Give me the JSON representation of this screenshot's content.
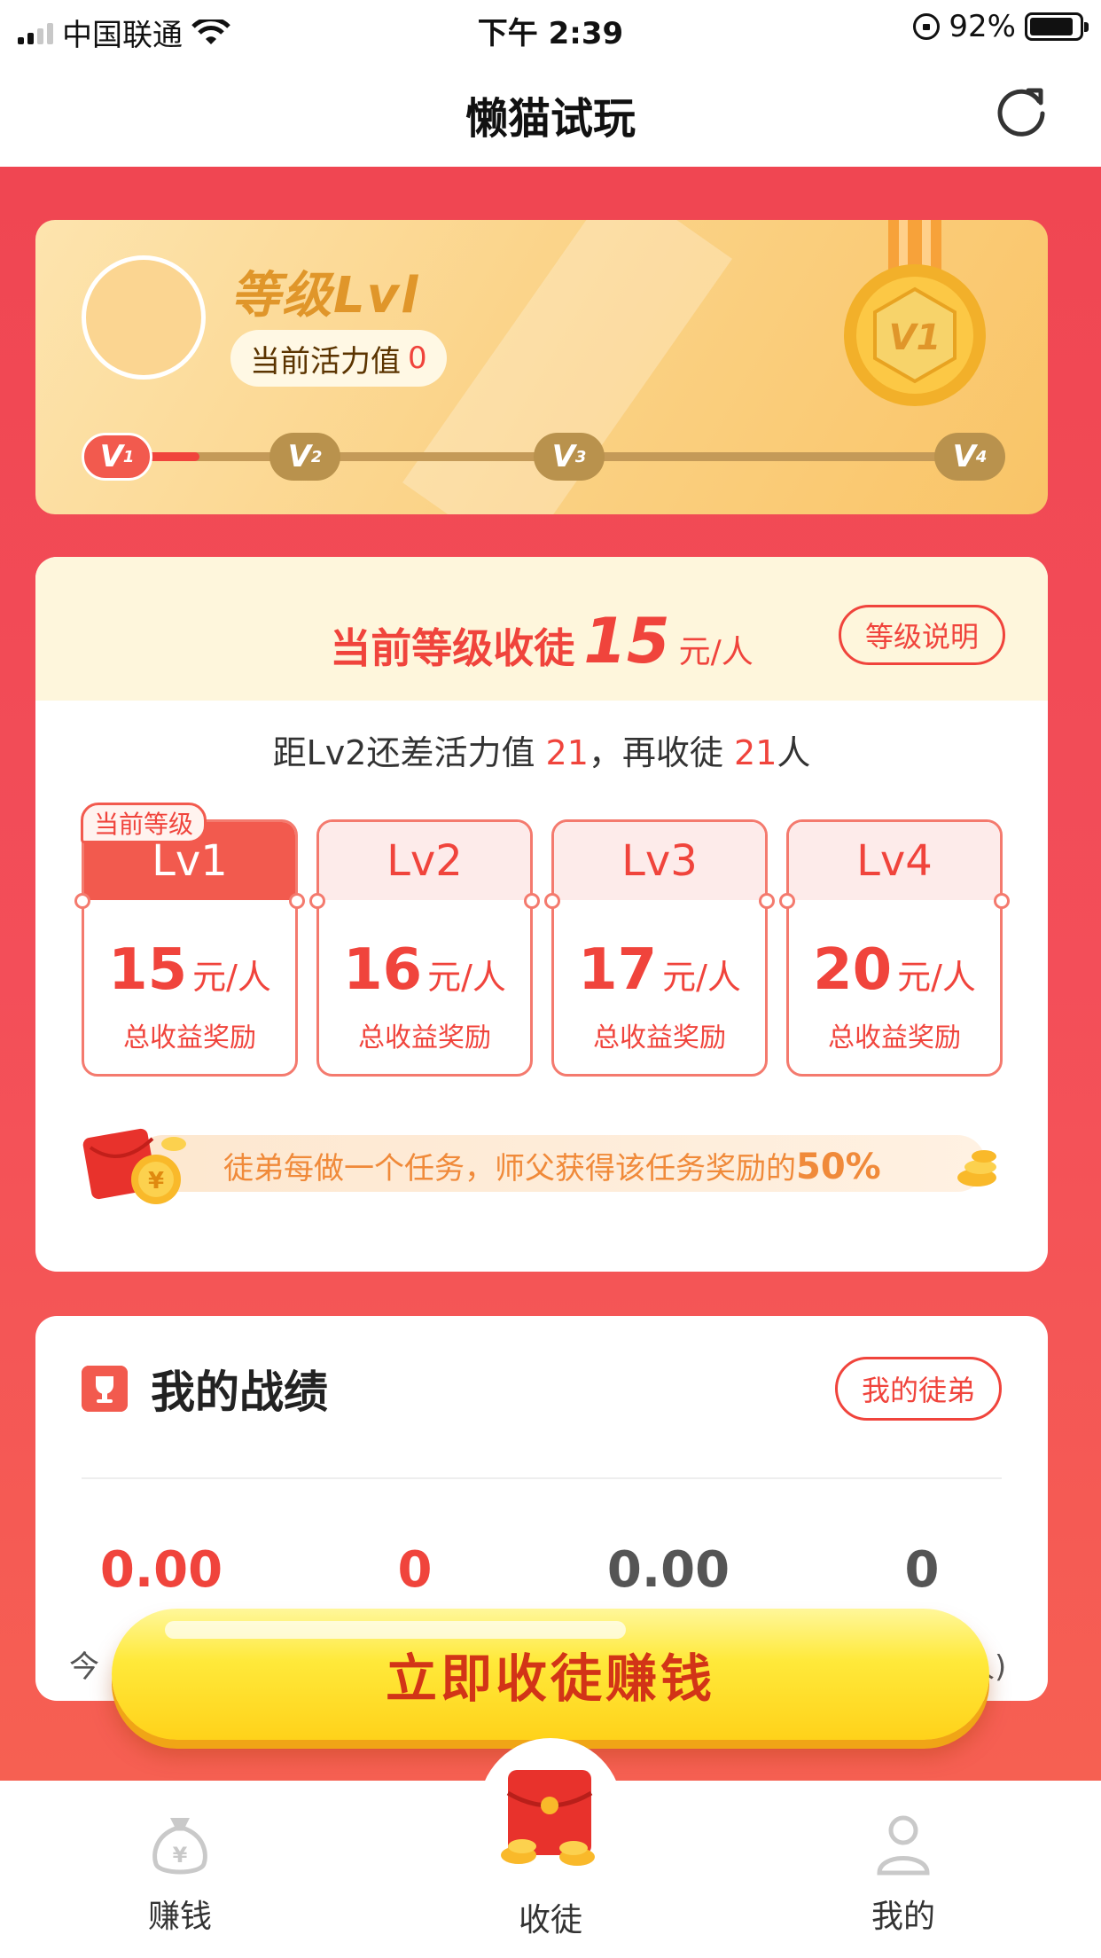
{
  "status_bar": {
    "carrier": "中国联通",
    "time": "下午 2:39",
    "battery": "92%"
  },
  "nav": {
    "title": "懒猫试玩",
    "refresh_icon": "refresh-icon"
  },
  "level_card": {
    "title": "等级Lvl",
    "activity_label": "当前活力值",
    "activity_value": "0",
    "progress_fraction": 0.03,
    "badges": [
      {
        "label": "V",
        "sub": "1"
      },
      {
        "label": "V",
        "sub": "2"
      },
      {
        "label": "V",
        "sub": "3"
      },
      {
        "label": "V",
        "sub": "4"
      }
    ],
    "medal_label": "V1"
  },
  "recruit": {
    "head_prefix": "当前等级收徒",
    "head_amount": "15",
    "head_unit": "元/人",
    "desc_button": "等级说明",
    "gap_prefix": "距Lv2还差活力值",
    "gap_value": "21",
    "gap_mid": "，再收徒",
    "gap_count": "21",
    "gap_suffix": "人",
    "current_tag": "当前等级",
    "tiers": [
      {
        "name": "Lv1",
        "price": "15",
        "unit": "元/人",
        "label": "总收益奖励"
      },
      {
        "name": "Lv2",
        "price": "16",
        "unit": "元/人",
        "label": "总收益奖励"
      },
      {
        "name": "Lv3",
        "price": "17",
        "unit": "元/人",
        "label": "总收益奖励"
      },
      {
        "name": "Lv4",
        "price": "20",
        "unit": "元/人",
        "label": "总收益奖励"
      }
    ],
    "tip_text": "徒弟每做一个任务，师父获得该任务奖励的",
    "tip_percent": "50%"
  },
  "record": {
    "title": "我的战绩",
    "apprentice_button": "我的徒弟",
    "stats": [
      "0.00",
      "0",
      "0.00",
      "0"
    ],
    "label_left_visible": "今",
    "label_right_visible": "人)"
  },
  "cta": {
    "label": "立即收徒赚钱"
  },
  "tabs": [
    {
      "label": "赚钱",
      "icon": "money-bag-icon"
    },
    {
      "label": "收徒",
      "icon": "red-envelope-icon"
    },
    {
      "label": "我的",
      "icon": "user-icon"
    }
  ],
  "colors": {
    "primary_red": "#f0443c",
    "gold": "#f9c467",
    "cta_yellow": "#ffe93a"
  }
}
